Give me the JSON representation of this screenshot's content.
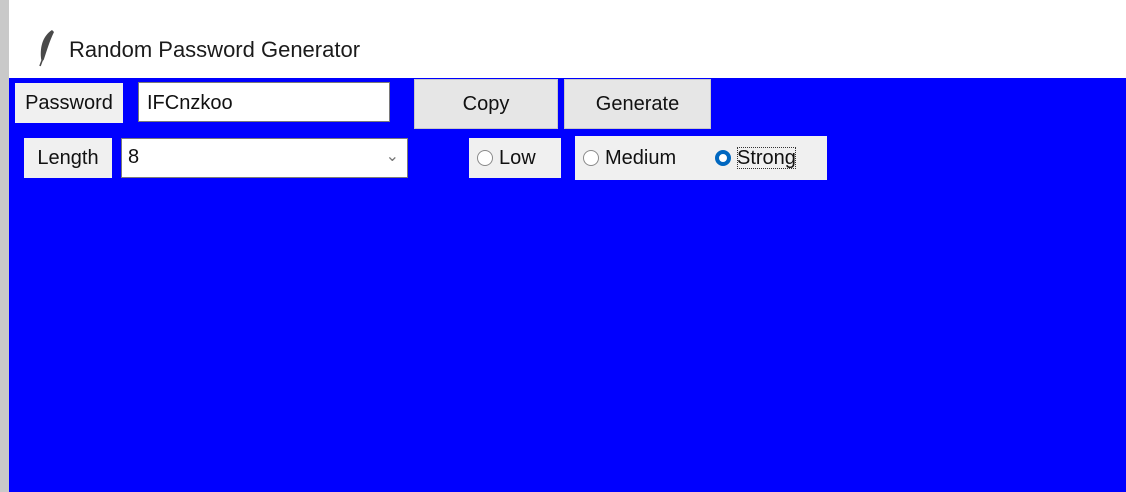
{
  "window": {
    "title": "Random Password Generator",
    "icon": "feather-icon"
  },
  "colors": {
    "background": "#0000ff",
    "widget": "#f0f0f0",
    "selected_radio": "#0067c0"
  },
  "password": {
    "label": "Password",
    "value": "IFCnzkoo"
  },
  "buttons": {
    "copy": "Copy",
    "generate": "Generate"
  },
  "length": {
    "label": "Length",
    "value": "8"
  },
  "strength": {
    "options": [
      "Low",
      "Medium",
      "Strong"
    ],
    "selected": "Strong"
  }
}
